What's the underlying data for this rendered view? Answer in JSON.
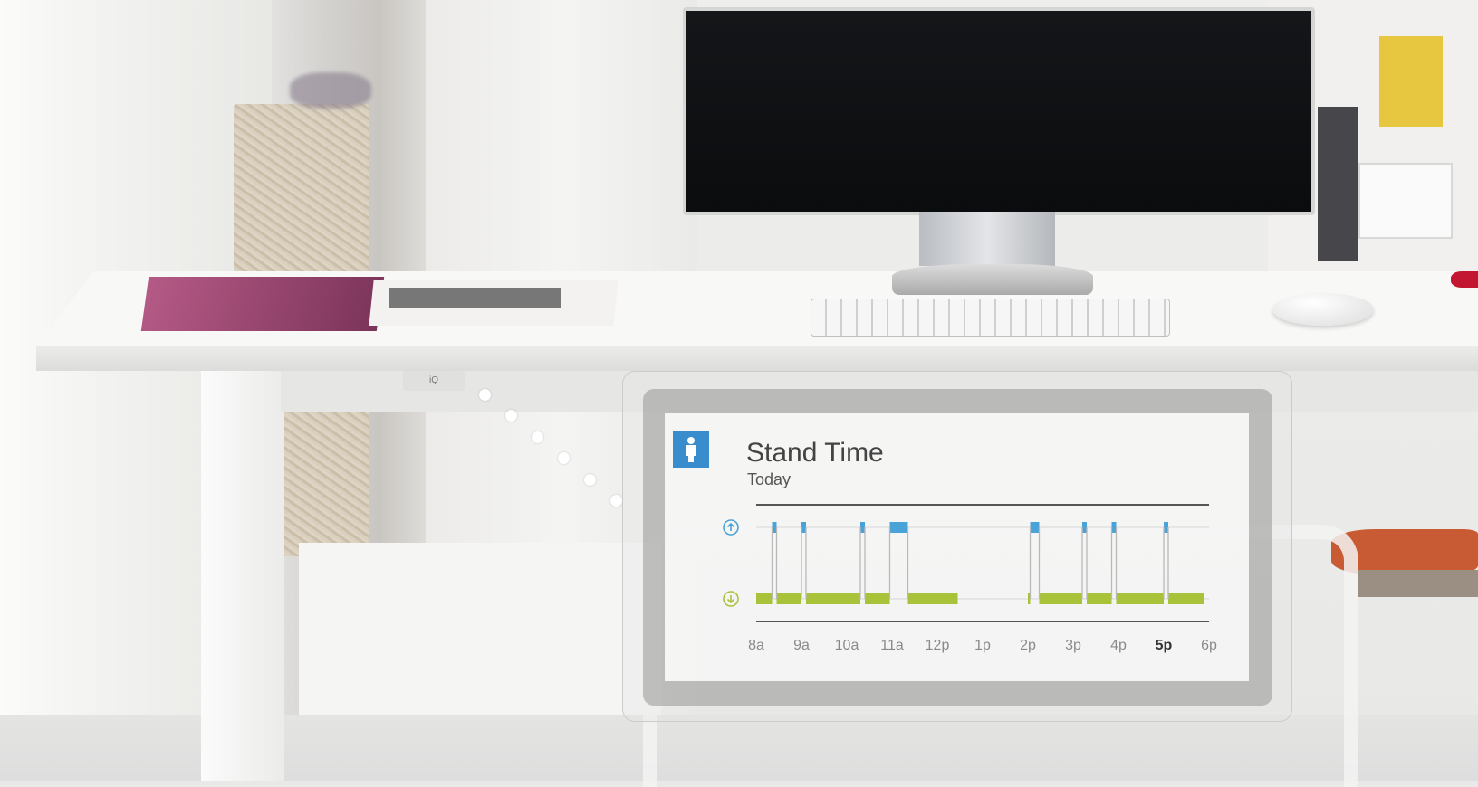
{
  "controller": {
    "label": "iQ"
  },
  "card": {
    "title": "Stand Time",
    "subtitle": "Today"
  },
  "colors": {
    "standing": "#4aa3d8",
    "sitting": "#a8c23a",
    "badge": "#3a8dcd"
  },
  "chart_data": {
    "type": "timeline",
    "x_unit": "hour",
    "xlim": [
      8,
      18
    ],
    "tick_labels": [
      "8a",
      "9a",
      "10a",
      "11a",
      "12p",
      "1p",
      "2p",
      "3p",
      "4p",
      "5p",
      "6p"
    ],
    "highlighted_tick": "5p",
    "levels": [
      "up-icon",
      "down-icon"
    ],
    "standing": [
      [
        8.35,
        8.45
      ],
      [
        9.0,
        9.1
      ],
      [
        10.3,
        10.4
      ],
      [
        10.95,
        11.35
      ],
      [
        14.05,
        14.25
      ],
      [
        15.2,
        15.3
      ],
      [
        15.85,
        15.95
      ],
      [
        17.0,
        17.1
      ]
    ],
    "sitting": [
      [
        8.0,
        8.35
      ],
      [
        8.45,
        9.0
      ],
      [
        9.1,
        10.3
      ],
      [
        10.4,
        10.95
      ],
      [
        11.35,
        12.45
      ],
      [
        14.0,
        14.05
      ],
      [
        14.25,
        15.2
      ],
      [
        15.3,
        15.85
      ],
      [
        15.95,
        17.0
      ],
      [
        17.1,
        17.9
      ]
    ]
  }
}
